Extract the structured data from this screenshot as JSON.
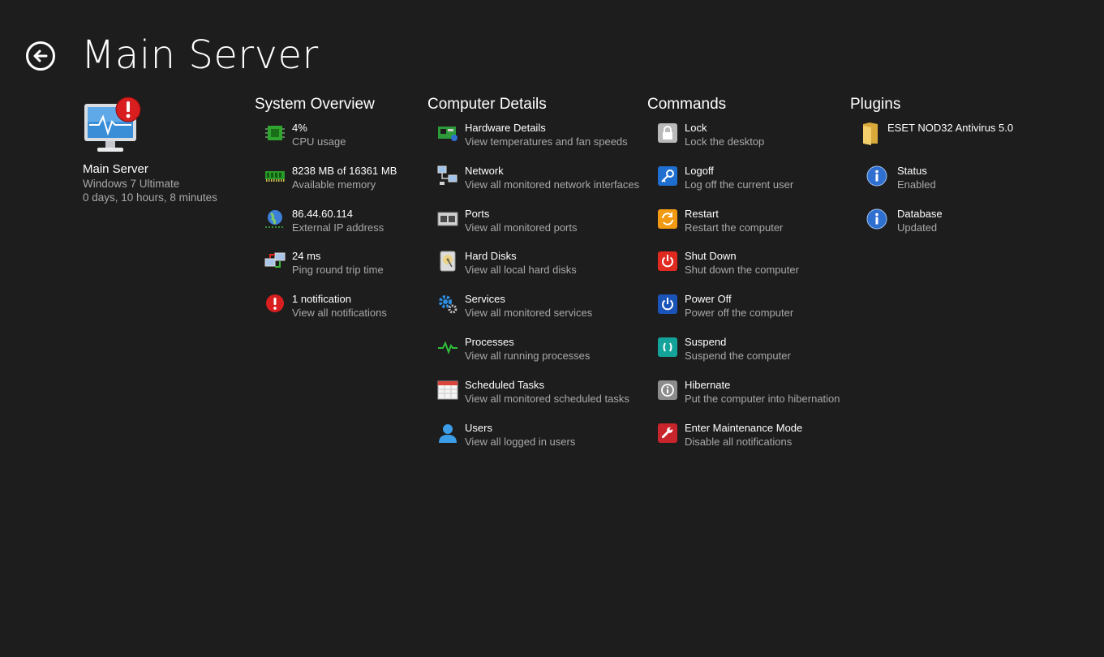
{
  "header": {
    "title": "Main Server"
  },
  "server": {
    "name": "Main Server",
    "os": "Windows 7 Ultimate",
    "uptime": "0 days, 10 hours, 8 minutes"
  },
  "overview": {
    "title": "System Overview",
    "items": [
      {
        "icon": "cpu-chip-icon",
        "primary": "4%",
        "secondary": "CPU usage"
      },
      {
        "icon": "memory-module-icon",
        "primary": "8238 MB of 16361 MB",
        "secondary": "Available memory"
      },
      {
        "icon": "globe-network-icon",
        "primary": "86.44.60.114",
        "secondary": "External IP address"
      },
      {
        "icon": "ping-network-icon",
        "primary": "24 ms",
        "secondary": "Ping round trip time"
      },
      {
        "icon": "alert-icon",
        "primary": "1 notification",
        "secondary": "View all notifications"
      }
    ]
  },
  "details": {
    "title": "Computer Details",
    "items": [
      {
        "icon": "hardware-board-icon",
        "primary": "Hardware Details",
        "secondary": "View temperatures and fan speeds"
      },
      {
        "icon": "network-computers-icon",
        "primary": "Network",
        "secondary": "View all monitored network interfaces"
      },
      {
        "icon": "ports-icon",
        "primary": "Ports",
        "secondary": "View all monitored ports"
      },
      {
        "icon": "hard-disk-icon",
        "primary": "Hard Disks",
        "secondary": "View all local hard disks"
      },
      {
        "icon": "gears-icon",
        "primary": "Services",
        "secondary": "View all monitored services"
      },
      {
        "icon": "pulse-icon",
        "primary": "Processes",
        "secondary": "View all running processes"
      },
      {
        "icon": "calendar-icon",
        "primary": "Scheduled Tasks",
        "secondary": "View all monitored scheduled tasks"
      },
      {
        "icon": "user-icon",
        "primary": "Users",
        "secondary": "View all logged in users"
      }
    ]
  },
  "commands": {
    "title": "Commands",
    "items": [
      {
        "icon": "lock-icon",
        "primary": "Lock",
        "secondary": "Lock the desktop",
        "color": "#b8b8b8"
      },
      {
        "icon": "key-icon",
        "primary": "Logoff",
        "secondary": "Log off the current user",
        "color": "#1e6fd0"
      },
      {
        "icon": "restart-icon",
        "primary": "Restart",
        "secondary": "Restart the computer",
        "color": "#f29a12"
      },
      {
        "icon": "power-icon",
        "primary": "Shut Down",
        "secondary": "Shut down the computer",
        "color": "#e02a20"
      },
      {
        "icon": "power-icon",
        "primary": "Power Off",
        "secondary": "Power off the computer",
        "color": "#1b54b8"
      },
      {
        "icon": "suspend-icon",
        "primary": "Suspend",
        "secondary": "Suspend the computer",
        "color": "#14a39a"
      },
      {
        "icon": "hibernate-icon",
        "primary": "Hibernate",
        "secondary": "Put the computer into hibernation",
        "color": "#8c8c8c"
      },
      {
        "icon": "wrench-icon",
        "primary": "Enter Maintenance Mode",
        "secondary": "Disable all notifications",
        "color": "#c8242b"
      }
    ]
  },
  "plugins": {
    "title": "Plugins",
    "items": [
      {
        "icon": "folder-icon",
        "primary": "ESET NOD32 Antivirus 5.0",
        "secondary": ""
      },
      {
        "icon": "info-icon",
        "primary": "Status",
        "secondary": "Enabled"
      },
      {
        "icon": "info-icon",
        "primary": "Database",
        "secondary": "Updated"
      }
    ]
  }
}
